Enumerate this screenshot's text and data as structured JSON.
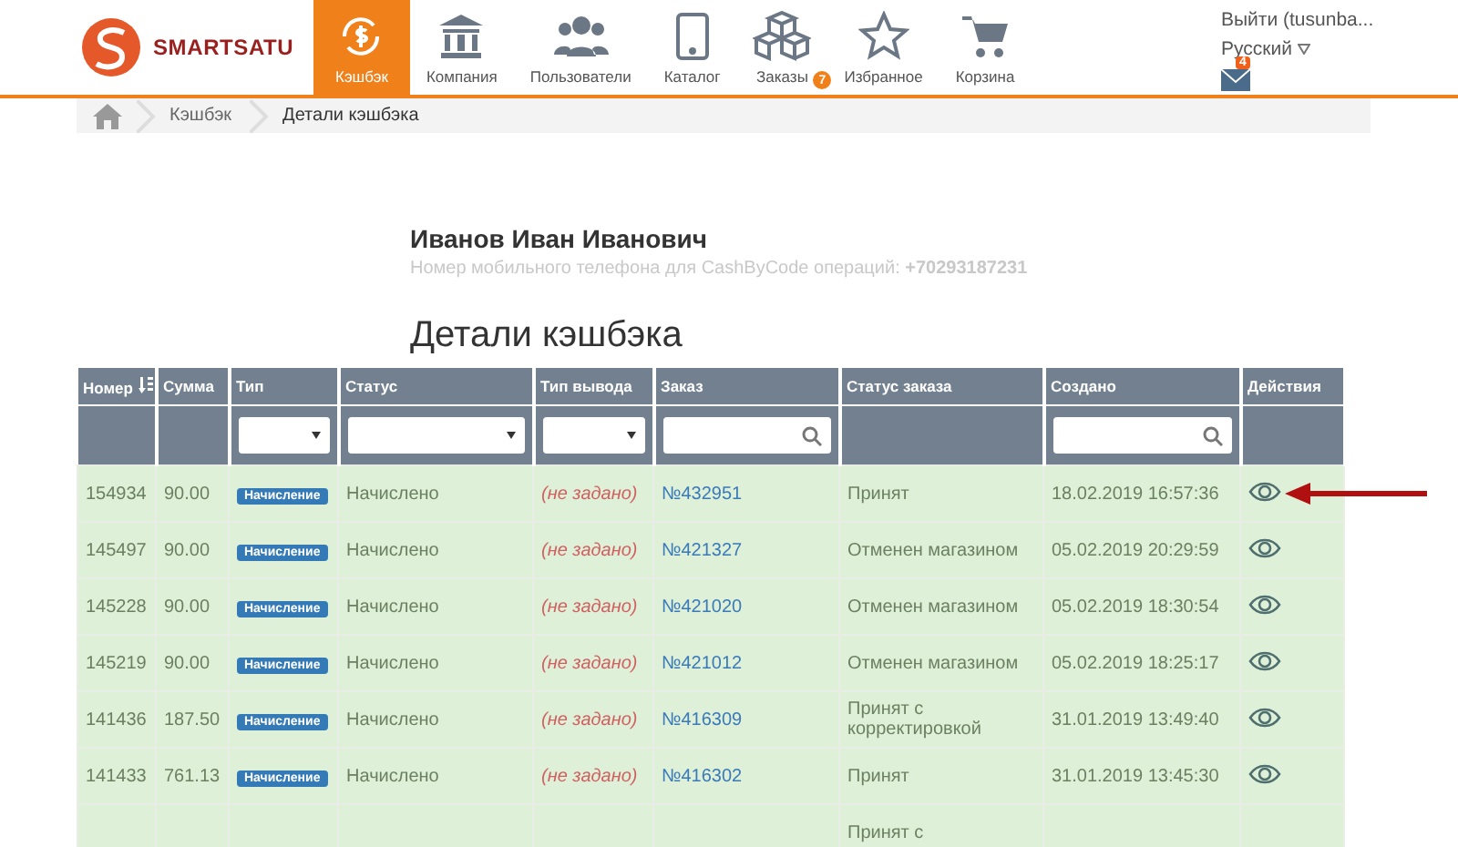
{
  "logo": {
    "text": "SMARTSATU"
  },
  "nav": [
    {
      "label": "Кэшбэк",
      "selected": true
    },
    {
      "label": "Компания",
      "selected": false
    },
    {
      "label": "Пользователи",
      "selected": false
    },
    {
      "label": "Каталог",
      "selected": false
    },
    {
      "label": "Заказы",
      "selected": false,
      "badge": "7"
    },
    {
      "label": "Избранное",
      "selected": false
    },
    {
      "label": "Корзина",
      "selected": false
    }
  ],
  "user_menu": {
    "logout": "Выйти (tusunba...",
    "language": "Русский",
    "messages_badge": "4"
  },
  "breadcrumbs": [
    "Кэшбэк",
    "Детали кэшбэка"
  ],
  "profile": {
    "name": "Иванов Иван Иванович",
    "phone_label": "Номер мобильного телефона для CashByCode операций:",
    "phone": "+70293187231"
  },
  "title": "Детали кэшбэка",
  "table": {
    "columns": [
      {
        "label": "Номер",
        "sortable": true,
        "kind": "plain"
      },
      {
        "label": "Сумма",
        "sortable": false,
        "kind": "plain"
      },
      {
        "label": "Тип",
        "sortable": false,
        "kind": "select"
      },
      {
        "label": "Статус",
        "sortable": false,
        "kind": "select"
      },
      {
        "label": "Тип вывода",
        "sortable": false,
        "kind": "select"
      },
      {
        "label": "Заказ",
        "sortable": false,
        "kind": "search"
      },
      {
        "label": "Статус заказа",
        "sortable": false,
        "kind": "plain"
      },
      {
        "label": "Создано",
        "sortable": false,
        "kind": "search"
      },
      {
        "label": "Действия",
        "sortable": false,
        "kind": "plain"
      }
    ],
    "rows": [
      {
        "number": "154934",
        "sum": "90.00",
        "type": "Начисление",
        "status": "Начислено",
        "payout": "(не задано)",
        "order": "№432951",
        "order_status": "Принят",
        "created": "18.02.2019 16:57:36"
      },
      {
        "number": "145497",
        "sum": "90.00",
        "type": "Начисление",
        "status": "Начислено",
        "payout": "(не задано)",
        "order": "№421327",
        "order_status": "Отменен магазином",
        "created": "05.02.2019 20:29:59"
      },
      {
        "number": "145228",
        "sum": "90.00",
        "type": "Начисление",
        "status": "Начислено",
        "payout": "(не задано)",
        "order": "№421020",
        "order_status": "Отменен магазином",
        "created": "05.02.2019 18:30:54"
      },
      {
        "number": "145219",
        "sum": "90.00",
        "type": "Начисление",
        "status": "Начислено",
        "payout": "(не задано)",
        "order": "№421012",
        "order_status": "Отменен магазином",
        "created": "05.02.2019 18:25:17"
      },
      {
        "number": "141436",
        "sum": "187.50",
        "type": "Начисление",
        "status": "Начислено",
        "payout": "(не задано)",
        "order": "№416309",
        "order_status": "Принят с корректировкой",
        "created": "31.01.2019 13:49:40"
      },
      {
        "number": "141433",
        "sum": "761.13",
        "type": "Начисление",
        "status": "Начислено",
        "payout": "(не задано)",
        "order": "№416302",
        "order_status": "Принят",
        "created": "31.01.2019 13:45:30"
      },
      {
        "order_status": "Принят с"
      }
    ]
  }
}
